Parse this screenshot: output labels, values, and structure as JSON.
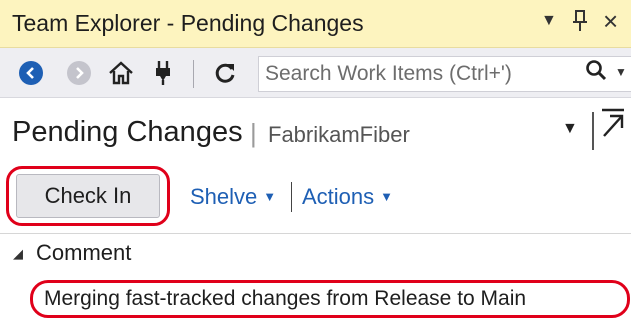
{
  "window": {
    "title": "Team Explorer - Pending Changes",
    "controls": {
      "dropdown": "▾",
      "pin": "📌",
      "close": "×"
    }
  },
  "toolbar": {
    "icons": [
      "back-icon",
      "forward-icon",
      "home-icon",
      "plug-icon",
      "refresh-icon"
    ],
    "search": {
      "placeholder": "Search Work Items (Ctrl+')",
      "value": ""
    }
  },
  "header": {
    "title": "Pending Changes",
    "separator": "|",
    "subtitle": "FabrikamFiber"
  },
  "actions": {
    "check_in_label": "Check In",
    "shelve_label": "Shelve",
    "actions_label": "Actions"
  },
  "comment": {
    "section_label": "Comment",
    "value": "Merging fast-tracked changes from Release to Main"
  },
  "colors": {
    "titlebar": "#fdf4bf",
    "toolbar": "#eeeef2",
    "link": "#1e5fb4",
    "highlight": "#e0001a"
  }
}
